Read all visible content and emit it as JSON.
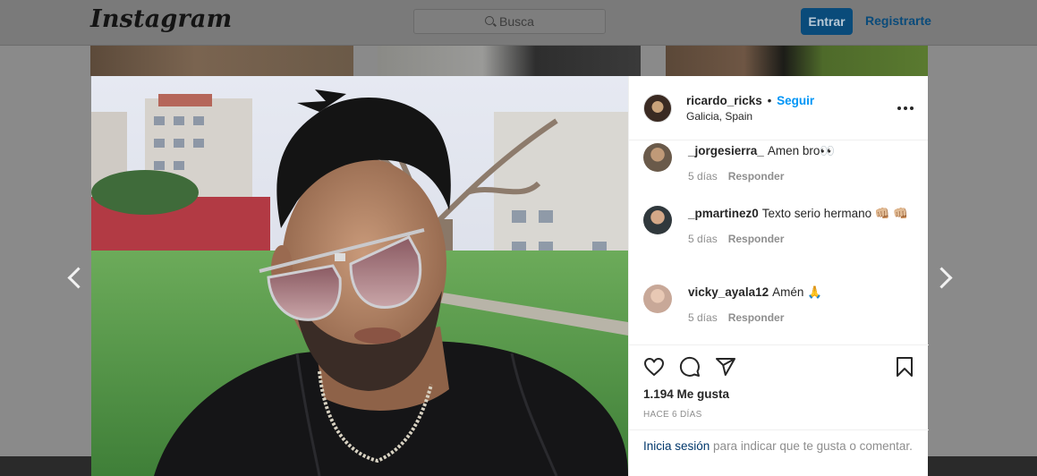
{
  "header": {
    "logo": "Instagram",
    "search_placeholder": "Busca",
    "login_label": "Entrar",
    "register_label": "Registrarte"
  },
  "post": {
    "username": "ricardo_ricks",
    "separator": "•",
    "follow_label": "Seguir",
    "location": "Galicia, Spain",
    "likes": "1.194 Me gusta",
    "time_ago": "HACE 6 DÍAS"
  },
  "comments": [
    {
      "user": "_jorgesierra_",
      "text": "Amen bro👀",
      "time": "5 días",
      "reply_label": "Responder"
    },
    {
      "user": "_pmartinez0",
      "text": "Texto serio hermano 👊🏼 👊🏼",
      "time": "5 días",
      "reply_label": "Responder"
    },
    {
      "user": "vicky_ayala12",
      "text": "Amén 🙏",
      "time": "5 días",
      "reply_label": "Responder"
    }
  ],
  "login_prompt": {
    "link": "Inicia sesión",
    "text": " para indicar que te gusta o comentar."
  },
  "colors": {
    "link_blue": "#0095f6",
    "login_blue": "#00376b",
    "overlay": "#8a8a8a"
  },
  "icons": [
    "search-icon",
    "chevron-left-icon",
    "chevron-right-icon",
    "more-icon",
    "heart-icon",
    "comment-icon",
    "share-icon",
    "bookmark-icon"
  ]
}
